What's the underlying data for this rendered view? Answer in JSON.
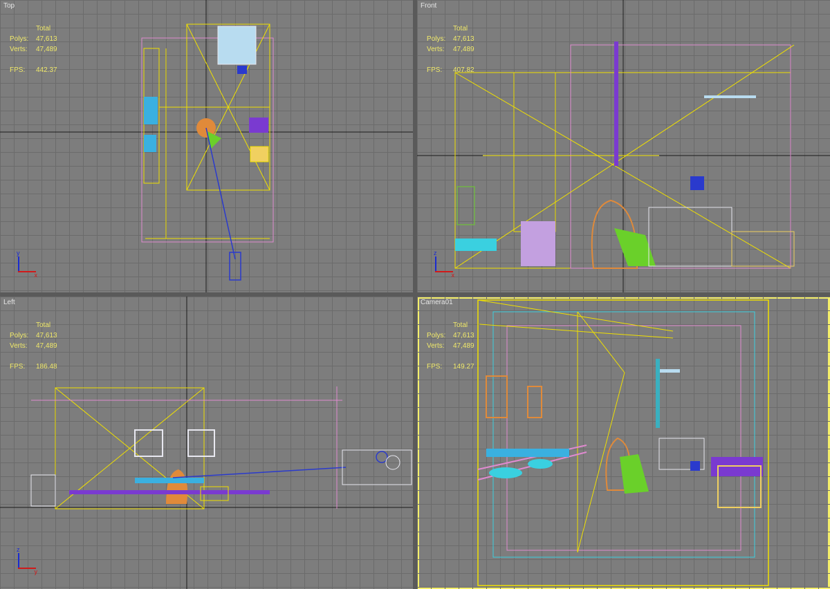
{
  "viewports": [
    {
      "id": "top",
      "label": "Top",
      "stats": {
        "header": "Total",
        "polys_label": "Polys:",
        "polys": "47,613",
        "verts_label": "Verts:",
        "verts": "47,489",
        "fps_label": "FPS:",
        "fps": "442.37"
      }
    },
    {
      "id": "front",
      "label": "Front",
      "stats": {
        "header": "Total",
        "polys_label": "Polys:",
        "polys": "47,613",
        "verts_label": "Verts:",
        "verts": "47,489",
        "fps_label": "FPS:",
        "fps": "407.82"
      }
    },
    {
      "id": "left",
      "label": "Left",
      "stats": {
        "header": "Total",
        "polys_label": "Polys:",
        "polys": "47,613",
        "verts_label": "Verts:",
        "verts": "47,489",
        "fps_label": "FPS:",
        "fps": "186.48"
      }
    },
    {
      "id": "camera",
      "label": "Camera01",
      "stats": {
        "header": "Total",
        "polys_label": "Polys:",
        "polys": "47,613",
        "verts_label": "Verts:",
        "verts": "47,489",
        "fps_label": "FPS:",
        "fps": "149.27"
      }
    }
  ],
  "axis": {
    "z": "z",
    "x": "x",
    "y": "y"
  },
  "colors": {
    "background": "#7d7d7d",
    "grid": "#6b6b6b",
    "grid_axis": "#1a1a1a",
    "stats_text": "#f0e96a",
    "active_border": "#f5ef6a",
    "wire_yellow": "#f0e000",
    "wire_pink": "#e08ad0",
    "wire_orange": "#e08a3a",
    "wire_green": "#6ad02a",
    "wire_blue": "#2a3acd",
    "wire_cyan": "#3ad0e0",
    "wire_purple": "#7a3ad0",
    "wire_white": "#e8e8f0"
  }
}
